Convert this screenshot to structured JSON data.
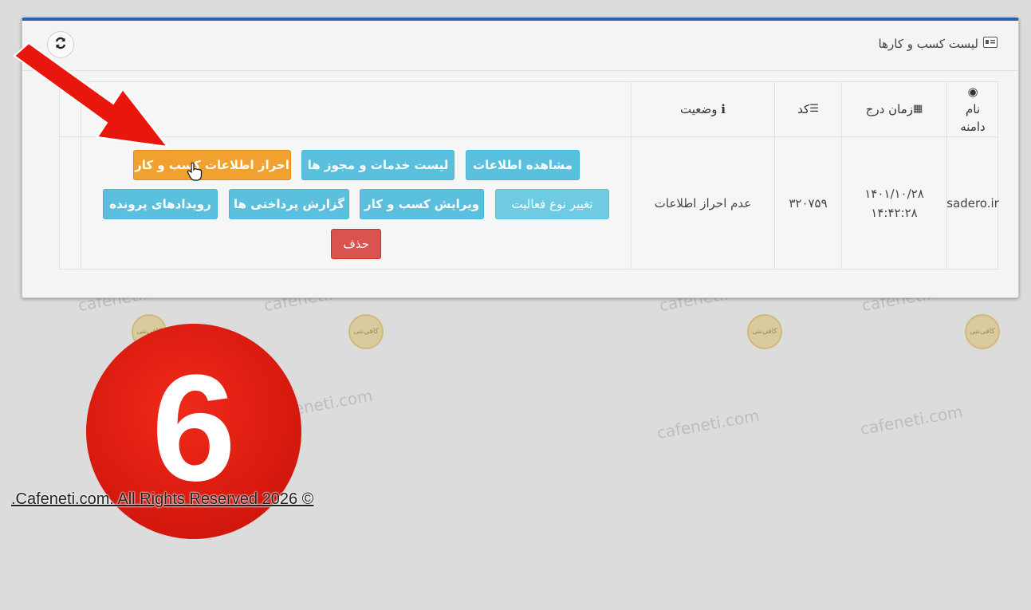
{
  "panel": {
    "title": "لیست کسب و کارها",
    "title_icon": "id-card-icon",
    "refresh_icon": "refresh-icon"
  },
  "table": {
    "headers": {
      "domain": "نام دامنه",
      "created": "زمان درج",
      "code": "کد",
      "status": "وضعیت"
    },
    "row": {
      "domain": "sadero.ir",
      "created_date": "۱۴۰۱/۱۰/۲۸",
      "created_time": "۱۴:۴۲:۲۸",
      "code": "۳۲۰۷۵۹",
      "status": "عدم احراز اطلاعات"
    },
    "actions": {
      "view": "مشاهده اطلاعات",
      "services": "لیست خدمات و مجوز ها",
      "verify": "احراز اطلاعات کسب و کار",
      "change_activity": "تغییر نوع فعالیت",
      "edit": "ویرایش کسب و کار",
      "payments": "گزارش پرداختی ها",
      "events": "رویدادهای پرونده",
      "delete": "حذف"
    }
  },
  "overlay": {
    "step_number": "6",
    "copyright": ".Cafeneti.com. All Rights Reserved 2026 ©",
    "watermark": "cafeneti.com",
    "logo_text": "کافی‌نتی"
  },
  "colors": {
    "accent_top": "#2d62b5",
    "info": "#5bc0de",
    "warning": "#f0a130",
    "danger": "#d9534f",
    "badge": "#d81a0f",
    "arrow": "#e8160c"
  }
}
